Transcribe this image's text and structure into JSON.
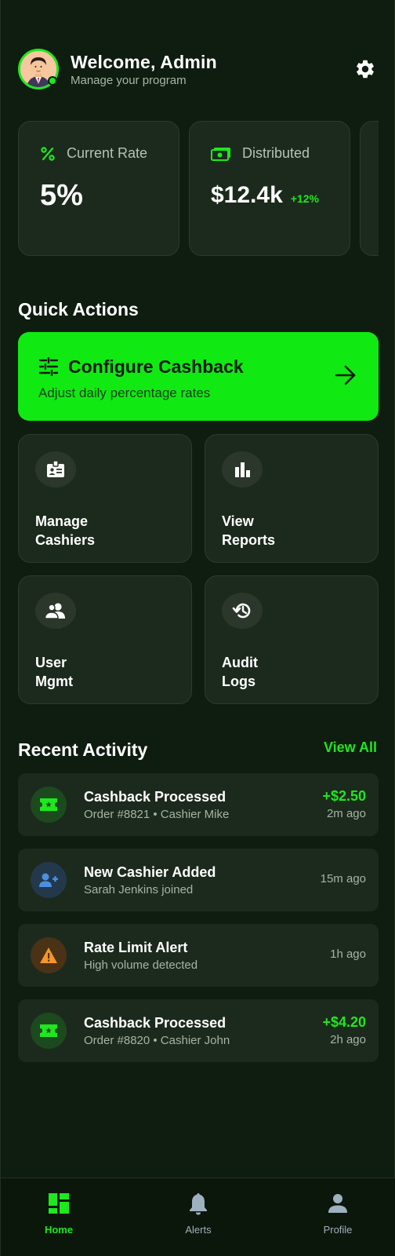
{
  "header": {
    "title": "Welcome, Admin",
    "subtitle": "Manage your program"
  },
  "stats": [
    {
      "label": "Current Rate",
      "value": "5%",
      "icon": "percent-icon"
    },
    {
      "label": "Distributed",
      "value": "$12.4k",
      "delta": "+12%",
      "icon": "money-icon"
    }
  ],
  "quick_actions": {
    "title": "Quick Actions",
    "configure": {
      "title": "Configure Cashback",
      "subtitle": "Adjust daily percentage rates"
    },
    "items": [
      {
        "label_line1": "Manage",
        "label_line2": "Cashiers",
        "icon": "badge-icon"
      },
      {
        "label_line1": "View",
        "label_line2": "Reports",
        "icon": "bar-chart-icon"
      },
      {
        "label_line1": "User",
        "label_line2": "Mgmt",
        "icon": "users-icon"
      },
      {
        "label_line1": "Audit",
        "label_line2": "Logs",
        "icon": "history-icon"
      }
    ]
  },
  "recent_activity": {
    "title": "Recent Activity",
    "view_all": "View All",
    "items": [
      {
        "title": "Cashback Processed",
        "subtitle": "Order #8821 • Cashier Mike",
        "amount": "+$2.50",
        "time": "2m ago",
        "icon": "ticket-icon"
      },
      {
        "title": "New Cashier Added",
        "subtitle": "Sarah Jenkins joined",
        "amount": "",
        "time": "15m ago",
        "icon": "user-add-icon"
      },
      {
        "title": "Rate Limit Alert",
        "subtitle": "High volume detected",
        "amount": "",
        "time": "1h ago",
        "icon": "warning-icon"
      },
      {
        "title": "Cashback Processed",
        "subtitle": "Order #8820 • Cashier John",
        "amount": "+$4.20",
        "time": "2h ago",
        "icon": "ticket-icon"
      }
    ]
  },
  "nav": {
    "items": [
      {
        "label": "Home",
        "icon": "dashboard-icon",
        "active": true
      },
      {
        "label": "Alerts",
        "icon": "bell-icon",
        "active": false
      },
      {
        "label": "Profile",
        "icon": "person-icon",
        "active": false
      }
    ]
  },
  "colors": {
    "accent": "#10ea12",
    "background": "#0f1c10",
    "card": "#1c2a1d"
  }
}
